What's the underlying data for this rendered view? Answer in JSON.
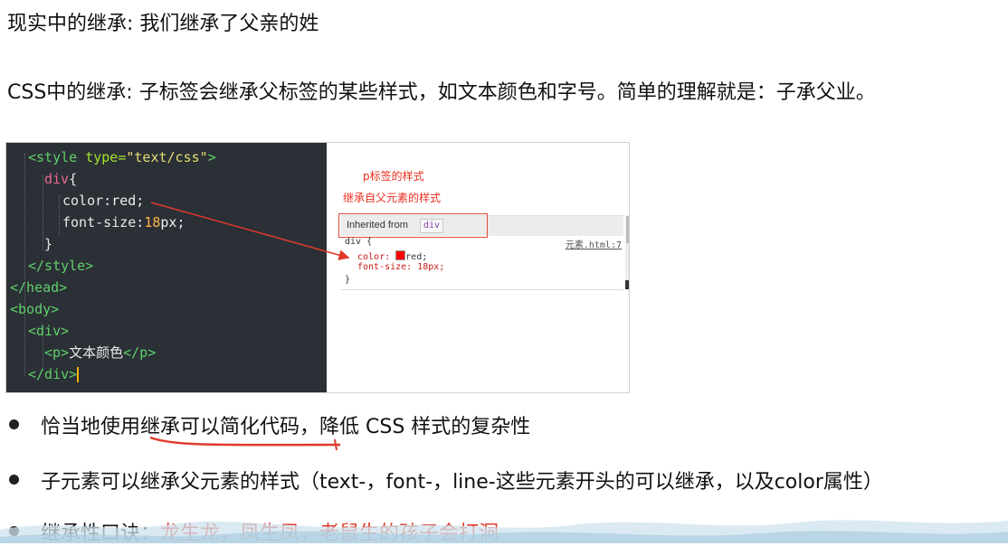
{
  "intro": {
    "line1": "现实中的继承: 我们继承了父亲的姓",
    "line2": "CSS中的继承: 子标签会继承父标签的某些样式，如文本颜色和字号。简单的理解就是：子承父业。"
  },
  "code_lines": [
    "<style type=\"text/css\">",
    "div{",
    "color:red;",
    "font-size:18px;",
    "}",
    "</style>",
    "</head>",
    "<body>",
    "<div>",
    "<p>文本颜色</p>",
    "</div>"
  ],
  "devtools": {
    "note_line1": "p标签的样式",
    "note_line2": "继承自父元素的样式",
    "inherited_label": "Inherited from",
    "inherited_chip": "div",
    "rule_selector": "div {",
    "rule_source": "元素.html:7",
    "rule_color_prop": "color:",
    "rule_color_value": "red;",
    "rule_size_line": "font-size: 18px;",
    "rule_close": "}"
  },
  "bullets": [
    {
      "text_a": "恰当地使用",
      "text_b": "继承可以简化代码",
      "text_c": "，降低 CSS 样式的复杂性"
    },
    {
      "text": "子元素可以继承父元素的样式（text-，font-，line-这些元素开头的可以继承，以及color属性）"
    },
    {
      "prefix": "继承性口诀：",
      "highlight": "龙生龙，凤生凤，老鼠生的孩子会打洞"
    }
  ],
  "colors": {
    "highlight": "#e03a2a",
    "code_bg": "#2b3036",
    "annotation": "#ea2f1f"
  }
}
